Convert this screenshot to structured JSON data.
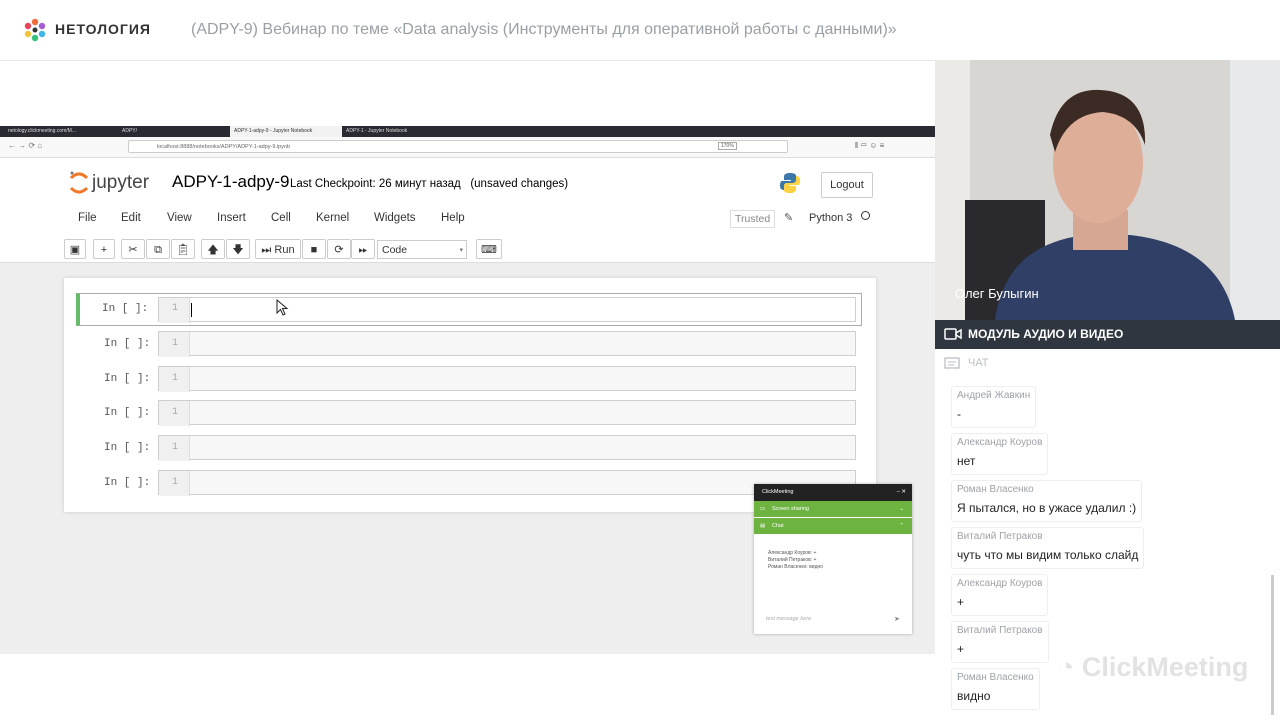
{
  "header": {
    "brand": "НЕТОЛОГИЯ",
    "webinar_title": "(ADPY-9) Вебинар по теме «Data analysis (Инструменты для оперативной работы с данными)»"
  },
  "browser": {
    "tabs": [
      "netology.clickmeeting.com/M...",
      "ADPY/",
      "ADPY-1-adpy-9 - Jupyter Notebook",
      "ADPY-1 - Jupyter Notebook"
    ],
    "url": "localhost:8888/notebooks/ADPY/ADPY-1-adpy-9.ipynb",
    "zoom": "170%"
  },
  "jupyter": {
    "logo_text": "jupyter",
    "notebook_title": "ADPY-1-adpy-9",
    "checkpoint": "Last Checkpoint: 26 минут назад",
    "unsaved": "(unsaved changes)",
    "logout": "Logout",
    "menu": [
      "File",
      "Edit",
      "View",
      "Insert",
      "Cell",
      "Kernel",
      "Widgets",
      "Help"
    ],
    "trusted": "Trusted",
    "kernel": "Python 3",
    "run_label": "Run",
    "cell_type": "Code",
    "cells": [
      {
        "prompt": "In [ ]:",
        "line": "1"
      },
      {
        "prompt": "In [ ]:",
        "line": "1"
      },
      {
        "prompt": "In [ ]:",
        "line": "1"
      },
      {
        "prompt": "In [ ]:",
        "line": "1"
      },
      {
        "prompt": "In [ ]:",
        "line": "1"
      },
      {
        "prompt": "In [ ]:",
        "line": "1"
      }
    ]
  },
  "cm_widget": {
    "title": "ClickMeeting",
    "screen_sharing": "Screen sharing",
    "chat": "Chat",
    "lines": [
      "Александр Коуров: +",
      "Виталий Петраков: +",
      "Роман Власенко: видно"
    ],
    "placeholder": "text message here"
  },
  "video": {
    "speaker": "Олег Булыгин",
    "module_label": "МОДУЛЬ АУДИО И ВИДЕО"
  },
  "chat": {
    "label": "ЧАТ",
    "messages": [
      {
        "author": "Андрей Жавкин",
        "text": "-"
      },
      {
        "author": "Александр Коуров",
        "text": "нет"
      },
      {
        "author": "Роман Власенко",
        "text": "Я пытался, но в ужасе удалил :)"
      },
      {
        "author": "Виталий Петраков",
        "text": "чуть что мы видим только слайд"
      },
      {
        "author": "Александр Коуров",
        "text": "+"
      },
      {
        "author": "Виталий Петраков",
        "text": "+"
      },
      {
        "author": "Роман Власенко",
        "text": "видно"
      }
    ],
    "watermark": "ClickMeeting"
  }
}
